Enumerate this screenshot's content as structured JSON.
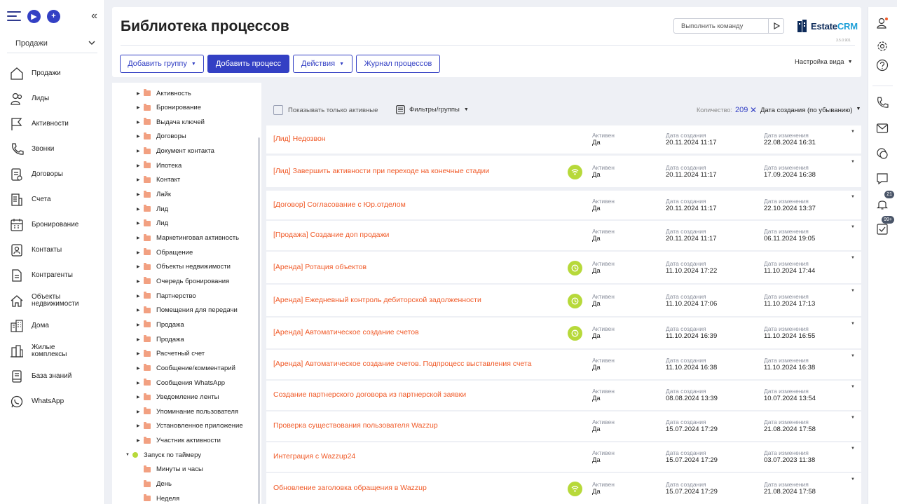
{
  "left_sidebar": {
    "section_select": "Продажи",
    "nav": [
      {
        "label": "Продажи",
        "icon": "house-icon"
      },
      {
        "label": "Лиды",
        "icon": "users-icon"
      },
      {
        "label": "Активности",
        "icon": "flag-icon"
      },
      {
        "label": "Звонки",
        "icon": "phone-icon"
      },
      {
        "label": "Договоры",
        "icon": "contract-icon"
      },
      {
        "label": "Счета",
        "icon": "invoice-icon"
      },
      {
        "label": "Бронирование",
        "icon": "calendar-icon"
      },
      {
        "label": "Контакты",
        "icon": "contact-card-icon"
      },
      {
        "label": "Контрагенты",
        "icon": "document-icon"
      },
      {
        "label": "Объекты недвижимости",
        "icon": "home-outline-icon"
      },
      {
        "label": "Дома",
        "icon": "buildings-icon"
      },
      {
        "label": "Жилые комплексы",
        "icon": "complex-icon"
      },
      {
        "label": "База знаний",
        "icon": "book-icon"
      },
      {
        "label": "WhatsApp",
        "icon": "whatsapp-icon"
      }
    ]
  },
  "header": {
    "title": "Библиотека процессов",
    "command_placeholder": "Выполнить команду",
    "logo_main": "Estate",
    "logo_accent": "CRM",
    "version": "3.5.0.901",
    "buttons": {
      "add_group": "Добавить группу",
      "add_process": "Добавить процесс",
      "actions": "Действия",
      "journal": "Журнал процессов"
    },
    "view_settings": "Настройка вида"
  },
  "tree": {
    "items": [
      "Активность",
      "Бронирование",
      "Выдача ключей",
      "Договоры",
      "Документ контакта",
      "Ипотека",
      "Контакт",
      "Лайк",
      "Лид",
      "Лид",
      "Маркетинговая активность",
      "Обращение",
      "Объекты недвижимости",
      "Очередь бронирования",
      "Партнерство",
      "Помещения для передачи",
      "Продажа",
      "Продажа",
      "Расчетный счет",
      "Сообщение/комментарий",
      "Сообщения WhatsApp",
      "Уведомление ленты",
      "Упоминание пользователя",
      "Установленное приложение",
      "Участник активности"
    ],
    "timer_group": "Запуск по таймеру",
    "timer_items": [
      "Минуты и часы",
      "День",
      "Неделя"
    ]
  },
  "toolbar": {
    "only_active": "Показывать только активные",
    "filters": "Фильтры/группы",
    "count_label": "Количество:",
    "count": "209",
    "sort": "Дата создания (по убыванию)"
  },
  "labels": {
    "active": "Активен",
    "created": "Дата создания",
    "modified": "Дата изменения"
  },
  "processes": [
    {
      "name": "[Лид] Недозвон",
      "active": "Да",
      "created": "20.11.2024 11:17",
      "modified": "22.08.2024 16:31",
      "badge": ""
    },
    {
      "name": "[Лид] Завершить активности при переходе на конечные стадии",
      "active": "Да",
      "created": "20.11.2024 11:17",
      "modified": "17.09.2024 16:38",
      "badge": "wifi"
    },
    {
      "name": "[Договор] Согласование с Юр.отделом",
      "active": "Да",
      "created": "20.11.2024 11:17",
      "modified": "22.10.2024 13:37",
      "badge": ""
    },
    {
      "name": "[Продажа] Создание доп продажи",
      "active": "Да",
      "created": "20.11.2024 11:17",
      "modified": "06.11.2024 19:05",
      "badge": ""
    },
    {
      "name": "[Аренда] Ротация объектов",
      "active": "Да",
      "created": "11.10.2024 17:22",
      "modified": "11.10.2024 17:44",
      "badge": "timer"
    },
    {
      "name": "[Аренда] Ежедневный контроль дебиторской задолженности",
      "active": "Да",
      "created": "11.10.2024 17:06",
      "modified": "11.10.2024 17:13",
      "badge": "timer"
    },
    {
      "name": "[Аренда] Автоматическое создание счетов",
      "active": "Да",
      "created": "11.10.2024 16:39",
      "modified": "11.10.2024 16:55",
      "badge": "timer"
    },
    {
      "name": "[Аренда] Автоматическое создание счетов. Подпроцесс выставления счета",
      "active": "Да",
      "created": "11.10.2024 16:38",
      "modified": "11.10.2024 16:38",
      "badge": ""
    },
    {
      "name": "Создание партнерского договора из партнерской заявки",
      "active": "Да",
      "created": "08.08.2024 13:39",
      "modified": "10.07.2024 13:54",
      "badge": ""
    },
    {
      "name": "Проверка существования пользователя Wazzup",
      "active": "Да",
      "created": "15.07.2024 17:29",
      "modified": "21.08.2024 17:58",
      "badge": ""
    },
    {
      "name": "Интеграция с Wazzup24",
      "active": "Да",
      "created": "15.07.2024 17:29",
      "modified": "03.07.2023 11:38",
      "badge": ""
    },
    {
      "name": "Обновление заголовка обращения в Wazzup",
      "active": "Да",
      "created": "15.07.2024 17:29",
      "modified": "21.08.2024 17:58",
      "badge": "wifi"
    }
  ],
  "right_rail": {
    "notifications_badge": "21",
    "tasks_badge": "99+"
  },
  "colors": {
    "primary": "#3340c4",
    "process_name": "#f05a28",
    "badge_green": "#b7d93a",
    "folder": "#f2a081"
  }
}
